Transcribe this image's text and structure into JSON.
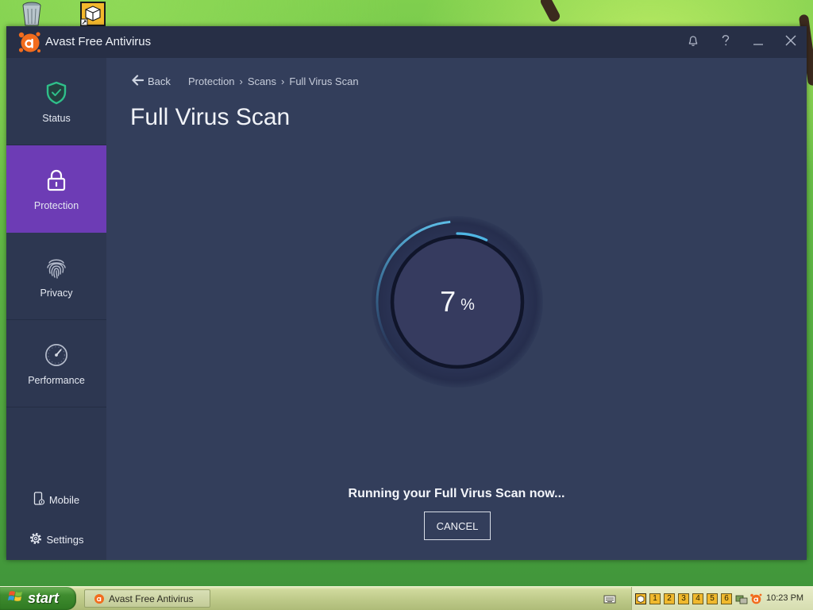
{
  "desktop": {
    "icons": [
      "recycle-bin-icon",
      "package-shortcut-icon"
    ]
  },
  "window": {
    "title": "Avast Free Antivirus",
    "controls": [
      "bell-icon",
      "help-icon",
      "minimize-icon",
      "close-icon"
    ]
  },
  "sidebar": {
    "items": [
      {
        "label": "Status",
        "icon": "shield-check-icon"
      },
      {
        "label": "Protection",
        "icon": "lock-icon",
        "selected": true
      },
      {
        "label": "Privacy",
        "icon": "fingerprint-icon"
      },
      {
        "label": "Performance",
        "icon": "gauge-icon"
      }
    ],
    "footer": [
      {
        "label": "Mobile",
        "icon": "mobile-icon"
      },
      {
        "label": "Settings",
        "icon": "gear-icon"
      }
    ]
  },
  "main": {
    "back_label": "Back",
    "breadcrumb": [
      "Protection",
      "Scans",
      "Full Virus Scan"
    ],
    "breadcrumb_separator": "›",
    "title": "Full Virus Scan",
    "progress": {
      "value": "7",
      "unit": "%",
      "fraction": 0.07
    },
    "status_text": "Running your Full Virus Scan now...",
    "cancel_label": "CANCEL"
  },
  "taskbar": {
    "start_label": "start",
    "tasks": [
      {
        "label": "Avast Free Antivirus",
        "icon": "avast-icon"
      }
    ],
    "tray_numbers": [
      "1",
      "2",
      "3",
      "4",
      "5",
      "6"
    ],
    "clock": "10:23 PM"
  },
  "colors": {
    "accent_purple": "#6d3cb5",
    "progress_blue": "#4fb6e4",
    "shield_green": "#2fbf8a",
    "avast_orange": "#f26c1d"
  }
}
